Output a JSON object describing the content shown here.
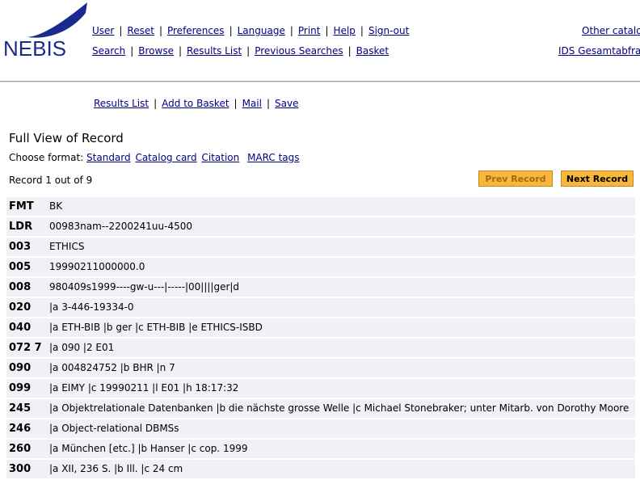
{
  "logo": {
    "text": "NEBIS"
  },
  "nav_top": [
    "User",
    "Reset",
    "Preferences",
    "Language",
    "Print",
    "Help",
    "Sign-out"
  ],
  "nav_bottom": [
    "Search",
    "Browse",
    "Results List",
    "Previous Searches",
    "Basket"
  ],
  "right_links": {
    "top": "Other catalo",
    "bottom": "IDS Gesamtabfra"
  },
  "subnav": [
    "Results List",
    "Add to Basket",
    "Mail",
    "Save"
  ],
  "page_title": "Full View of Record",
  "format": {
    "label": "Choose format:",
    "options": [
      "Standard",
      "Catalog card",
      "Citation",
      "MARC tags"
    ]
  },
  "record_count": "Record 1 out of 9",
  "buttons": {
    "prev": "Prev Record",
    "next": "Next Record"
  },
  "colors": {
    "link": "#000080",
    "row_bg": "#f0f0f5",
    "button": "#f6b73c",
    "logo_blue": "#1b2a8f"
  },
  "records": [
    {
      "tag": "FMT",
      "value": "BK"
    },
    {
      "tag": "LDR",
      "value": "00983nam--2200241uu-4500"
    },
    {
      "tag": "003",
      "value": "ETHICS"
    },
    {
      "tag": "005",
      "value": "19990211000000.0"
    },
    {
      "tag": "008",
      "value": "980409s1999----gw-u---|-----|00||||ger|d"
    },
    {
      "tag": "020",
      "value": "|a 3-446-19334-0"
    },
    {
      "tag": "040",
      "value": "|a ETH-BIB |b ger |c ETH-BIB |e ETHICS-ISBD"
    },
    {
      "tag": "072 7",
      "value": "|a 090 |2 E01"
    },
    {
      "tag": "090",
      "value": "|a 004824752 |b BHR |n 7"
    },
    {
      "tag": "099",
      "value": "|a EIMY |c 19990211 |l E01 |h 18:17:32"
    },
    {
      "tag": "245",
      "value": "|a Objektrelationale Datenbanken |b die nächste grosse Welle |c Michael Stonebraker; unter Mitarb. von Dorothy Moore"
    },
    {
      "tag": "246",
      "value": "|a Object-relational DBMSs"
    },
    {
      "tag": "260",
      "value": "|a München [etc.] |b Hanser |c cop. 1999"
    },
    {
      "tag": "300",
      "value": "|a XII, 236 S. |b Ill. |c 24 cm"
    }
  ]
}
